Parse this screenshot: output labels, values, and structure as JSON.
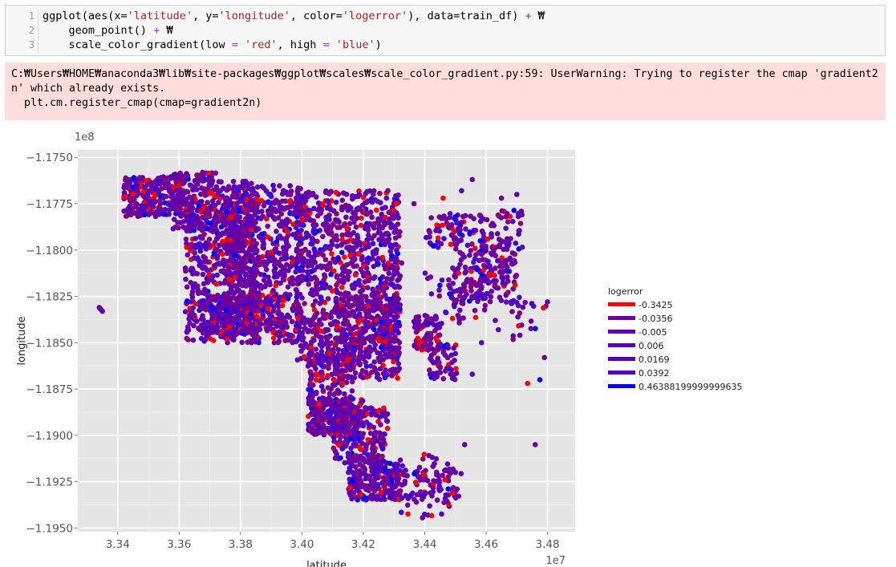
{
  "code_cell": {
    "line_numbers": [
      "1",
      "2",
      "3"
    ],
    "lines": [
      [
        {
          "t": "ggplot(aes(x=",
          "c": "plain"
        },
        {
          "t": "'latitude'",
          "c": "str"
        },
        {
          "t": ", y=",
          "c": "plain"
        },
        {
          "t": "'longitude'",
          "c": "str"
        },
        {
          "t": ", color=",
          "c": "plain"
        },
        {
          "t": "'logerror'",
          "c": "str"
        },
        {
          "t": "), data=train_df) ",
          "c": "plain"
        },
        {
          "t": "+",
          "c": "op"
        },
        {
          "t": " ₩",
          "c": "plain"
        }
      ],
      [
        {
          "t": "    geom_point() ",
          "c": "plain"
        },
        {
          "t": "+",
          "c": "op"
        },
        {
          "t": " ₩",
          "c": "plain"
        }
      ],
      [
        {
          "t": "    scale_color_gradient(low ",
          "c": "plain"
        },
        {
          "t": "=",
          "c": "op"
        },
        {
          "t": " ",
          "c": "plain"
        },
        {
          "t": "'red'",
          "c": "str"
        },
        {
          "t": ", high ",
          "c": "plain"
        },
        {
          "t": "=",
          "c": "op"
        },
        {
          "t": " ",
          "c": "plain"
        },
        {
          "t": "'blue'",
          "c": "str"
        },
        {
          "t": ")",
          "c": "plain"
        }
      ]
    ]
  },
  "stderr": {
    "line1": "C:₩Users₩HOME₩anaconda3₩lib₩site-packages₩ggplot₩scales₩scale_color_gradient.py:59: UserWarning: Trying to register the cmap 'gradient2",
    "line2": "n' which already exists.",
    "line3": "  plt.cm.register_cmap(cmap=gradient2n)"
  },
  "chart_data": {
    "type": "scatter",
    "xlabel": "latitude",
    "ylabel": "longitude",
    "x_offset_label": "1e7",
    "y_offset_label": "1e8",
    "x_ticks": [
      "3.34",
      "3.36",
      "3.38",
      "3.40",
      "3.42",
      "3.44",
      "3.46",
      "3.48"
    ],
    "y_ticks": [
      "−1.1750",
      "−1.1775",
      "−1.1800",
      "−1.1825",
      "−1.1850",
      "−1.1875",
      "−1.1900",
      "−1.1925",
      "−1.1950"
    ],
    "xlim": [
      3.327,
      3.489
    ],
    "ylim": [
      -1.1952,
      -1.1746
    ],
    "grid": true,
    "legend_placement": "right",
    "legend": {
      "title": "logerror",
      "entries": [
        {
          "label": "-0.3425",
          "color": "#ff0000"
        },
        {
          "label": "-0.0356",
          "color": "#6d009d"
        },
        {
          "label": "-0.005",
          "color": "#6200b0"
        },
        {
          "label": "0.006",
          "color": "#5d00b8"
        },
        {
          "label": "0.0169",
          "color": "#5800c0"
        },
        {
          "label": "0.0392",
          "color": "#4f00cf"
        },
        {
          "label": "0.46388199999999635",
          "color": "#0000ff"
        }
      ]
    },
    "regions": [
      {
        "xlo": 3.342,
        "xhi": 3.362,
        "ylo": -1.1782,
        "yhi": -1.176,
        "n": 260
      },
      {
        "xlo": 3.358,
        "xhi": 3.372,
        "ylo": -1.179,
        "yhi": -1.1758,
        "n": 200
      },
      {
        "xlo": 3.362,
        "xhi": 3.385,
        "ylo": -1.185,
        "yhi": -1.1775,
        "n": 520
      },
      {
        "xlo": 3.372,
        "xhi": 3.384,
        "ylo": -1.18,
        "yhi": -1.1762,
        "n": 150
      },
      {
        "xlo": 3.375,
        "xhi": 3.4,
        "ylo": -1.185,
        "yhi": -1.1765,
        "n": 650
      },
      {
        "xlo": 3.398,
        "xhi": 3.432,
        "ylo": -1.186,
        "yhi": -1.1768,
        "n": 950
      },
      {
        "xlo": 3.367,
        "xhi": 3.39,
        "ylo": -1.1845,
        "yhi": -1.1825,
        "n": 220
      },
      {
        "xlo": 3.41,
        "xhi": 3.432,
        "ylo": -1.187,
        "yhi": -1.1825,
        "n": 300
      },
      {
        "xlo": 3.402,
        "xhi": 3.417,
        "ylo": -1.19,
        "yhi": -1.1855,
        "n": 250
      },
      {
        "xlo": 3.403,
        "xhi": 3.42,
        "ylo": -1.19,
        "yhi": -1.188,
        "n": 160
      },
      {
        "xlo": 3.41,
        "xhi": 3.428,
        "ylo": -1.1915,
        "yhi": -1.1885,
        "n": 220
      },
      {
        "xlo": 3.415,
        "xhi": 3.432,
        "ylo": -1.1935,
        "yhi": -1.1915,
        "n": 180
      },
      {
        "xlo": 3.425,
        "xhi": 3.452,
        "ylo": -1.1935,
        "yhi": -1.1918,
        "n": 100
      },
      {
        "xlo": 3.436,
        "xhi": 3.445,
        "ylo": -1.1855,
        "yhi": -1.1835,
        "n": 90
      },
      {
        "xlo": 3.441,
        "xhi": 3.451,
        "ylo": -1.187,
        "yhi": -1.185,
        "n": 60
      },
      {
        "xlo": 3.448,
        "xhi": 3.46,
        "ylo": -1.183,
        "yhi": -1.178,
        "n": 120
      },
      {
        "xlo": 3.458,
        "xhi": 3.47,
        "ylo": -1.183,
        "yhi": -1.1795,
        "n": 110
      },
      {
        "xlo": 3.44,
        "xhi": 3.452,
        "ylo": -1.18,
        "yhi": -1.178,
        "n": 40
      },
      {
        "xlo": 3.458,
        "xhi": 3.472,
        "ylo": -1.18,
        "yhi": -1.1778,
        "n": 45
      },
      {
        "xlo": 3.44,
        "xhi": 3.46,
        "ylo": -1.184,
        "yhi": -1.181,
        "n": 40
      },
      {
        "xlo": 3.432,
        "xhi": 3.448,
        "ylo": -1.1945,
        "yhi": -1.191,
        "n": 40
      },
      {
        "xlo": 3.468,
        "xhi": 3.481,
        "ylo": -1.185,
        "yhi": -1.1825,
        "n": 18
      }
    ],
    "outliers": [
      {
        "x": 3.3345,
        "y": -1.1832
      },
      {
        "x": 3.335,
        "y": -1.1833
      },
      {
        "x": 3.334,
        "y": -1.1831
      },
      {
        "x": 3.437,
        "y": -1.1838
      },
      {
        "x": 3.438,
        "y": -1.1836
      },
      {
        "x": 3.476,
        "y": -1.1905
      },
      {
        "x": 3.479,
        "y": -1.1858
      },
      {
        "x": 3.4775,
        "y": -1.187
      },
      {
        "x": 3.4735,
        "y": -1.1872
      },
      {
        "x": 3.48,
        "y": -1.1828
      },
      {
        "x": 3.465,
        "y": -1.1772
      },
      {
        "x": 3.47,
        "y": -1.177
      },
      {
        "x": 3.4555,
        "y": -1.1762
      },
      {
        "x": 3.452,
        "y": -1.1768
      },
      {
        "x": 3.446,
        "y": -1.1772
      },
      {
        "x": 3.428,
        "y": -1.1768
      },
      {
        "x": 3.4365,
        "y": -1.1775
      },
      {
        "x": 3.4325,
        "y": -1.1807
      },
      {
        "x": 3.4555,
        "y": -1.1825
      },
      {
        "x": 3.463,
        "y": -1.1838
      },
      {
        "x": 3.464,
        "y": -1.1843
      },
      {
        "x": 3.471,
        "y": -1.1846
      },
      {
        "x": 3.4705,
        "y": -1.183
      },
      {
        "x": 3.4585,
        "y": -1.185
      },
      {
        "x": 3.4555,
        "y": -1.1867
      },
      {
        "x": 3.453,
        "y": -1.1905
      },
      {
        "x": 3.45,
        "y": -1.192
      }
    ]
  }
}
